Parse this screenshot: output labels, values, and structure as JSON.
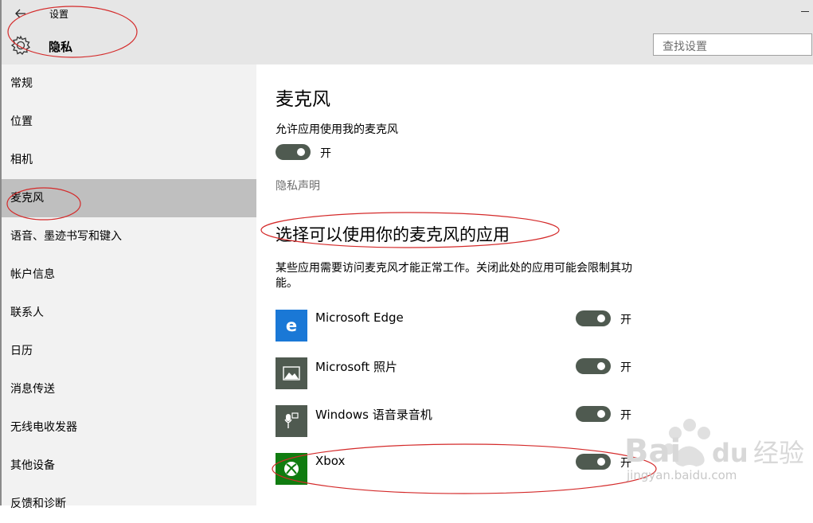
{
  "window": {
    "title": "设置"
  },
  "header": {
    "page_title": "隐私",
    "search_placeholder": "查找设置"
  },
  "sidebar": {
    "items": [
      {
        "label": "常规"
      },
      {
        "label": "位置"
      },
      {
        "label": "相机"
      },
      {
        "label": "麦克风",
        "selected": true
      },
      {
        "label": "语音、墨迹书写和键入"
      },
      {
        "label": "帐户信息"
      },
      {
        "label": "联系人"
      },
      {
        "label": "日历"
      },
      {
        "label": "消息传送"
      },
      {
        "label": "无线电收发器"
      },
      {
        "label": "其他设备"
      },
      {
        "label": "反馈和诊断"
      }
    ]
  },
  "main": {
    "title": "麦克风",
    "allow_label": "允许应用使用我的麦克风",
    "allow_state": "开",
    "privacy_link": "隐私声明",
    "section_title": "选择可以使用你的麦克风的应用",
    "section_desc": "某些应用需要访问麦克风才能正常工作。关闭此处的应用可能会限制其功能。",
    "apps": [
      {
        "name": "Microsoft Edge",
        "state": "开",
        "icon": "edge-icon",
        "color": "#1a78d6"
      },
      {
        "name": "Microsoft 照片",
        "state": "开",
        "icon": "photos-icon",
        "color": "#4f5a50"
      },
      {
        "name": "Windows 语音录音机",
        "state": "开",
        "icon": "voice-recorder-icon",
        "color": "#4f5a50"
      },
      {
        "name": "Xbox",
        "state": "开",
        "icon": "xbox-icon",
        "color": "#107c10"
      }
    ]
  },
  "watermark": {
    "brand": "Baidu经验",
    "url": "jingyan.baidu.com"
  },
  "colors": {
    "toggle_on": "#4f5a50",
    "annotation": "#d42a2a",
    "sidebar_selected": "#bfbfbf"
  }
}
